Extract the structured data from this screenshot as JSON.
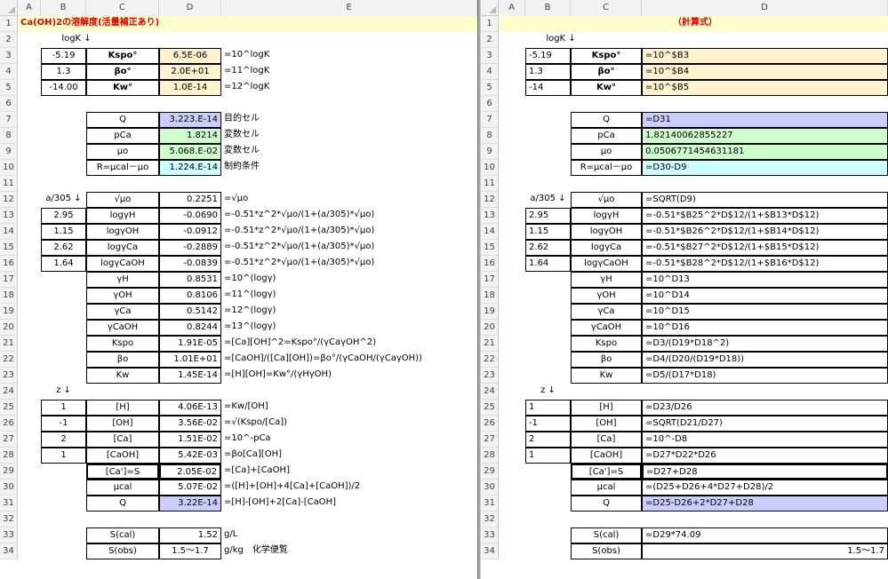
{
  "columns_left": [
    "A",
    "B",
    "C",
    "D",
    "E"
  ],
  "columns_right": [
    "A",
    "B",
    "C",
    "D"
  ],
  "row_numbers": [
    "1",
    "2",
    "3",
    "4",
    "5",
    "6",
    "7",
    "8",
    "9",
    "10",
    "11",
    "12",
    "13",
    "14",
    "15",
    "16",
    "17",
    "18",
    "19",
    "20",
    "21",
    "22",
    "23",
    "24",
    "25",
    "26",
    "27",
    "28",
    "29",
    "30",
    "31",
    "32",
    "33",
    "34"
  ],
  "left": {
    "title": "Ca(OH)2の溶解度(活量補正あり)",
    "logk_label": "logK ↓",
    "a305_label": "a/305 ↓",
    "z_label": "z ↓",
    "B": {
      "3": "-5.19",
      "4": "1.3",
      "5": "-14.00",
      "13": "2.95",
      "14": "1.15",
      "15": "2.62",
      "16": "1.64",
      "25": "1",
      "26": "-1",
      "27": "2",
      "28": "1"
    },
    "C": {
      "3": "Kspo°",
      "4": "βo°",
      "5": "Kw°",
      "7": "Q",
      "8": "pCa",
      "9": "μo",
      "10": "R=μcal－μo",
      "12": "√μo",
      "13": "logγH",
      "14": "logγOH",
      "15": "logγCa",
      "16": "logγCaOH",
      "17": "γH",
      "18": "γOH",
      "19": "γCa",
      "20": "γCaOH",
      "21": "Kspo",
      "22": "βo",
      "23": "Kw",
      "25": "[H]",
      "26": "[OH]",
      "27": "[Ca]",
      "28": "[CaOH]",
      "29": "[Ca']=S",
      "30": "μcal",
      "31": "Q",
      "33": "S(cal)",
      "34": "S(obs)"
    },
    "D": {
      "3": "6.5E-06",
      "4": "2.0E+01",
      "5": "1.0E-14",
      "7": "3.223.E-14",
      "8": "1.8214",
      "9": "5.068.E-02",
      "10": "1.224.E-14",
      "12": "0.2251",
      "13": "-0.0690",
      "14": "-0.0912",
      "15": "-0.2889",
      "16": "-0.0839",
      "17": "0.8531",
      "18": "0.8106",
      "19": "0.5142",
      "20": "0.8244",
      "21": "1.91E-05",
      "22": "1.01E+01",
      "23": "1.45E-14",
      "25": "4.06E-13",
      "26": "3.56E-02",
      "27": "1.51E-02",
      "28": "5.42E-03",
      "29": "2.05E-02",
      "30": "5.07E-02",
      "31": "3.22E-14",
      "33": "1.52",
      "34": "1.5～1.7"
    },
    "E": {
      "3": "=10^logK",
      "4": "=11^logK",
      "5": "=12^logK",
      "7": "目的セル",
      "8": "変数セル",
      "9": "変数セル",
      "10": "制約条件",
      "12": "=√μo",
      "13": "=-0.51*z^2*√μo/(1+(a/305)*√μo)",
      "14": "=-0.51*z^2*√μo/(1+(a/305)*√μo)",
      "15": "=-0.51*z^2*√μo/(1+(a/305)*√μo)",
      "16": "=-0.51*z^2*√μo/(1+(a/305)*√μo)",
      "17": "=10^(logγ)",
      "18": "=11^(logγ)",
      "19": "=12^(logγ)",
      "20": "=13^(logγ)",
      "21": "=[Ca][OH]^2=Kspo°/(γCaγOH^2)",
      "22": "=[CaOH]/([Ca][OH])=βo°/(γCaOH/(γCaγOH))",
      "23": "=[H][OH]=Kw°/(γHγOH)",
      "25": "=Kw/[OH]",
      "26": "=√(Kspo/[Ca])",
      "27": "=10^-pCa",
      "28": "=βo[Ca][OH]",
      "29": "=[Ca]+[CaOH]",
      "30": "=([H]+[OH]+4[Ca]+[CaOH])/2",
      "31": "=[H]-[OH]+2[Ca]-[CaOH]",
      "33": "g/L",
      "34": "g/kg　化学便覧"
    }
  },
  "right": {
    "title": "（計算式）",
    "logk_label": "logK ↓",
    "a305_label": "a/305 ↓",
    "z_label": "z ↓",
    "B": {
      "3": "-5.19",
      "4": "1.3",
      "5": "-14",
      "13": "2.95",
      "14": "1.15",
      "15": "2.62",
      "16": "1.64",
      "25": "1",
      "26": "-1",
      "27": "2",
      "28": "1"
    },
    "C": {
      "3": "Kspo°",
      "4": "βo°",
      "5": "Kw°",
      "7": "Q",
      "8": "pCa",
      "9": "μo",
      "10": "R=μcal－μo",
      "12": "√μo",
      "13": "logγH",
      "14": "logγOH",
      "15": "logγCa",
      "16": "logγCaOH",
      "17": "γH",
      "18": "γOH",
      "19": "γCa",
      "20": "γCaOH",
      "21": "Kspo",
      "22": "βo",
      "23": "Kw",
      "25": "[H]",
      "26": "[OH]",
      "27": "[Ca]",
      "28": "[CaOH]",
      "29": "[Ca']=S",
      "30": "μcal",
      "31": "Q",
      "33": "S(cal)",
      "34": "S(obs)"
    },
    "D": {
      "3": "=10^$B3",
      "4": "=10^$B4",
      "5": "=10^$B5",
      "7": "=D31",
      "8": "1.82140062855227",
      "9": "0.0506771454631181",
      "10": "=D30-D9",
      "12": "=SQRT(D9)",
      "13": "=-0.51*$B25^2*D$12/(1+$B13*D$12)",
      "14": "=-0.51*$B26^2*D$12/(1+$B14*D$12)",
      "15": "=-0.51*$B27^2*D$12/(1+$B15*D$12)",
      "16": "=-0.51*$B28^2*D$12/(1+$B16*D$12)",
      "17": "=10^D13",
      "18": "=10^D14",
      "19": "=10^D15",
      "20": "=10^D16",
      "21": "=D3/(D19*D18^2)",
      "22": "=D4/(D20/(D19*D18))",
      "23": "=D5/(D17*D18)",
      "25": "=D23/D26",
      "26": "=SQRT(D21/D27)",
      "27": "=10^-D8",
      "28": "=D27*D22*D26",
      "29": "=D27+D28",
      "30": "=(D25+D26+4*D27+D28)/2",
      "31": "=D25-D26+2*D27+D28",
      "33": "=D29*74.09",
      "34": "1.5～1.7"
    }
  },
  "colors": {
    "yellow": "#fff2cc",
    "green": "#ccffcc",
    "purple": "#ccccff",
    "cyan": "#ccffff",
    "title_bg": "#ffffcc",
    "title_text": "#e00000"
  }
}
